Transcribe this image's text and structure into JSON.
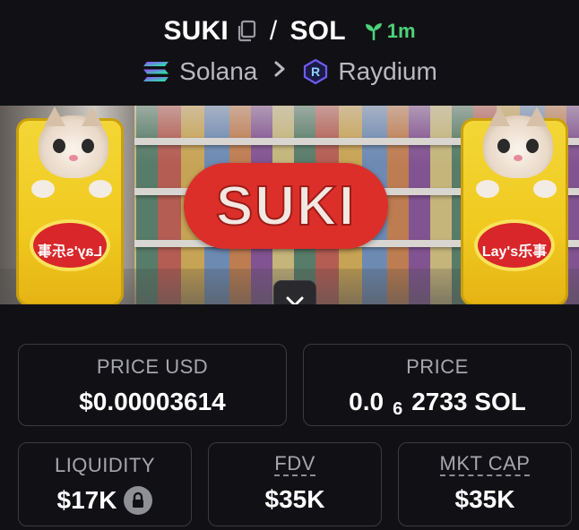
{
  "header": {
    "base_symbol": "SUKI",
    "separator": "/",
    "quote_symbol": "SOL",
    "age": "1m",
    "chain": {
      "name": "Solana",
      "icon": "solana-icon"
    },
    "dex": {
      "name": "Raydium",
      "icon": "raydium-icon"
    },
    "breadcrumb_separator": ">"
  },
  "banner": {
    "logo_text": "SUKI",
    "bag_text_left": "Lay's乐事",
    "bag_text_right": "Lay's乐事"
  },
  "stats": {
    "price_usd": {
      "label": "PRICE USD",
      "value": "$0.00003614"
    },
    "price_native": {
      "label": "PRICE",
      "prefix": "0.0",
      "subscript": "6",
      "suffix": "2733 SOL"
    },
    "liquidity": {
      "label": "LIQUIDITY",
      "value": "$17K",
      "icon": "lock-icon"
    },
    "fdv": {
      "label": "FDV",
      "value": "$35K"
    },
    "mkt_cap": {
      "label": "MKT CAP",
      "value": "$35K"
    }
  },
  "colors": {
    "background": "#111115",
    "accent_green": "#4fd17a",
    "muted_text": "#a6a6ad",
    "card_border": "#3a3a40"
  }
}
